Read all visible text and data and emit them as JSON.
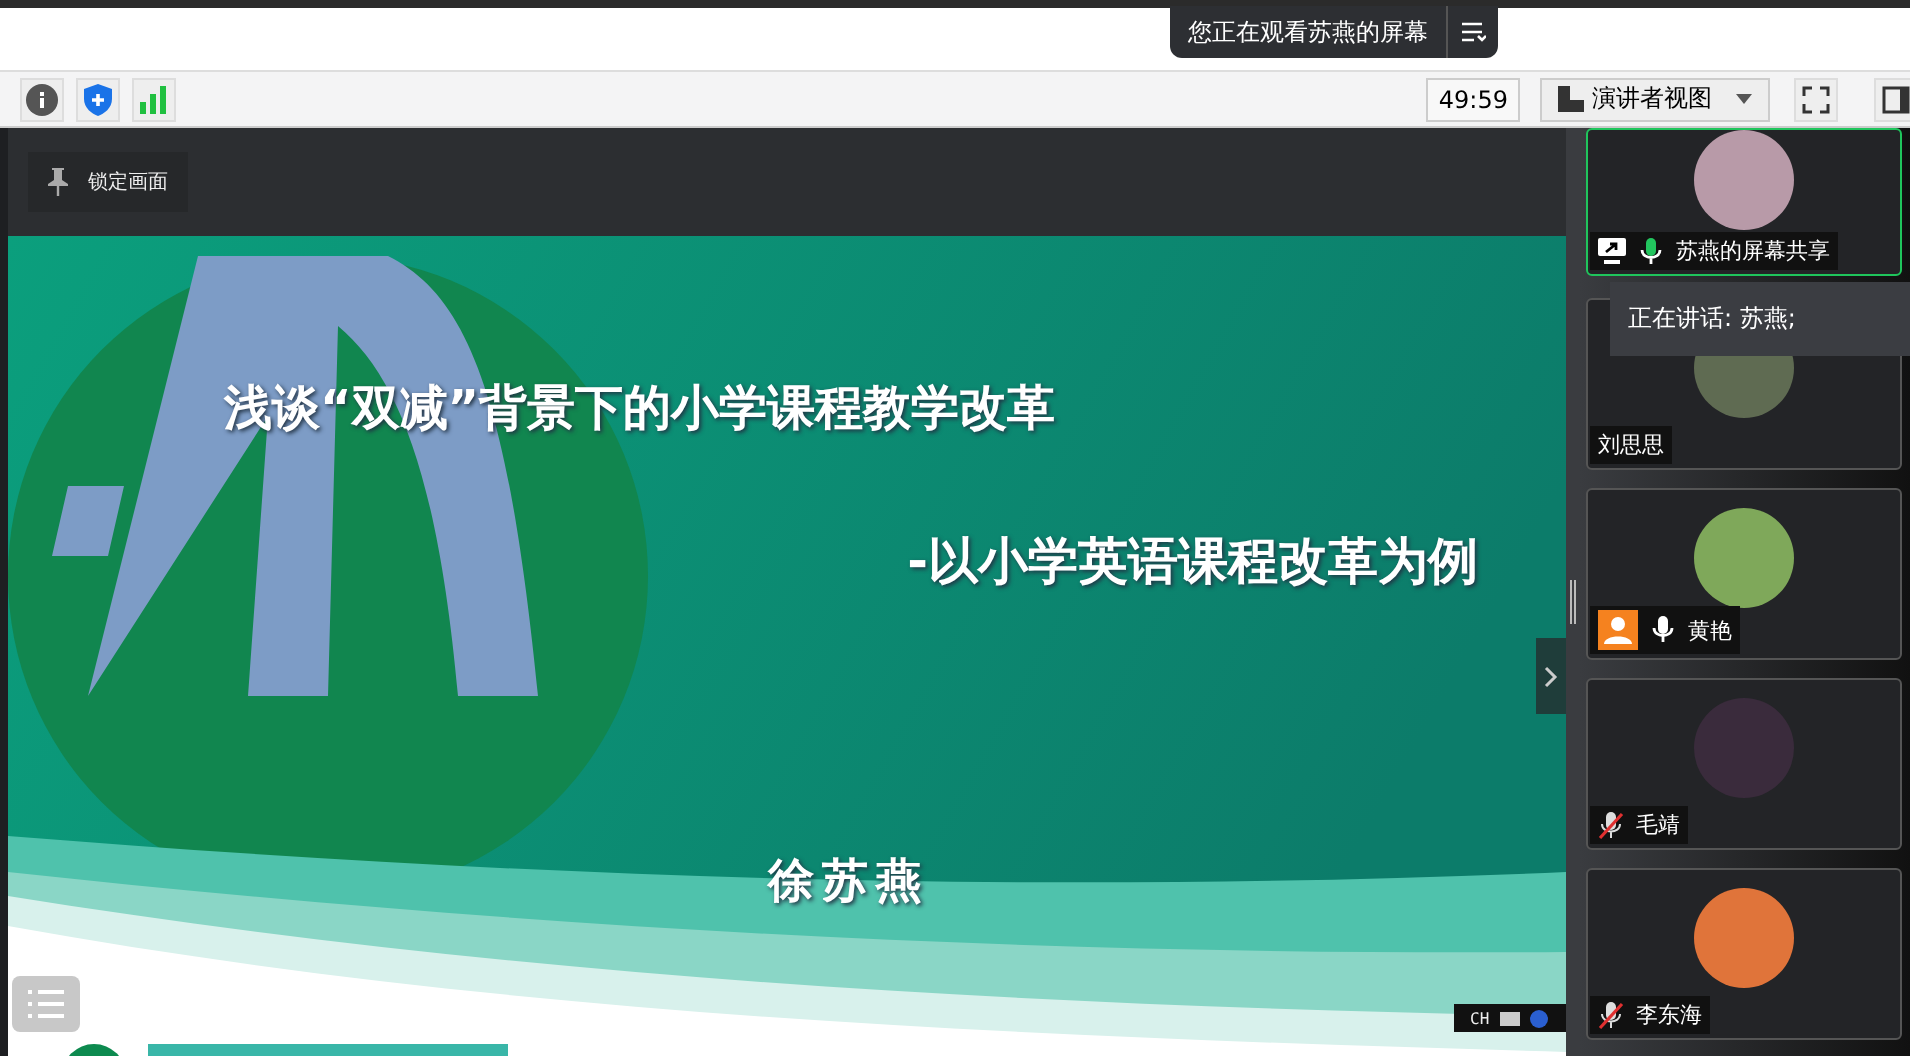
{
  "banner": {
    "text": "您正在观看苏燕的屏幕"
  },
  "toolbar": {
    "timer": "49:59",
    "view_button": "演讲者视图"
  },
  "slide": {
    "pin_button": "锁定画面",
    "title": "浅谈“双减”背景下的小学课程教学改革",
    "subtitle": "-以小学英语课程改革为例",
    "author": "徐苏燕"
  },
  "ime_bar": {
    "language": "CH"
  },
  "participants": [
    {
      "name": "苏燕的屏幕共享",
      "kind": "sharing",
      "selected": true,
      "mic_shown": true,
      "speaking": true,
      "muted": false
    },
    {
      "name": "刘思思",
      "kind": "plain",
      "selected": false,
      "mic_shown": false,
      "speaking": false,
      "muted": false
    },
    {
      "name": "黄艳",
      "kind": "camera-off",
      "selected": false,
      "mic_shown": true,
      "speaking": false,
      "muted": false
    },
    {
      "name": "毛靖",
      "kind": "plain",
      "selected": false,
      "mic_shown": true,
      "speaking": false,
      "muted": true
    },
    {
      "name": "李东海",
      "kind": "plain",
      "selected": false,
      "mic_shown": true,
      "speaking": false,
      "muted": true
    }
  ],
  "speaking_tooltip": "正在讲话: 苏燕;"
}
